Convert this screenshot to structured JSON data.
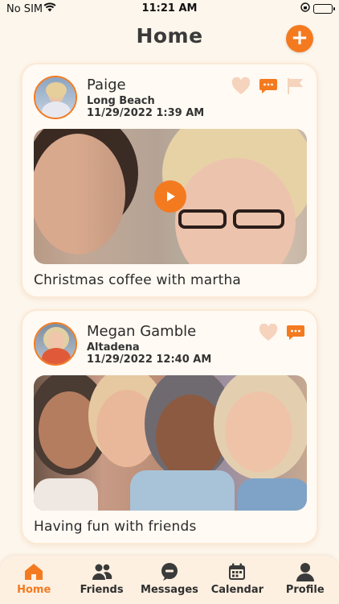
{
  "status": {
    "carrier": "No SIM",
    "time": "11:21 AM"
  },
  "header": {
    "title": "Home"
  },
  "posts": [
    {
      "name": "Paige",
      "location": "Long Beach",
      "timestamp": "11/29/2022 1:39 AM",
      "caption": "Christmas coffee with martha",
      "media_type": "video"
    },
    {
      "name": "Megan Gamble",
      "location": "Altadena",
      "timestamp": "11/29/2022 12:40 AM",
      "caption": "Having fun with friends",
      "media_type": "photo"
    }
  ],
  "tabs": [
    {
      "label": "Home",
      "icon": "home-icon",
      "active": true
    },
    {
      "label": "Friends",
      "icon": "friends-icon",
      "active": false
    },
    {
      "label": "Messages",
      "icon": "messages-icon",
      "active": false
    },
    {
      "label": "Calendar",
      "icon": "calendar-icon",
      "active": false
    },
    {
      "label": "Profile",
      "icon": "profile-icon",
      "active": false
    }
  ],
  "colors": {
    "accent": "#f47a20",
    "background": "#fdf6ec",
    "muted_heart": "#f6d3bd"
  }
}
